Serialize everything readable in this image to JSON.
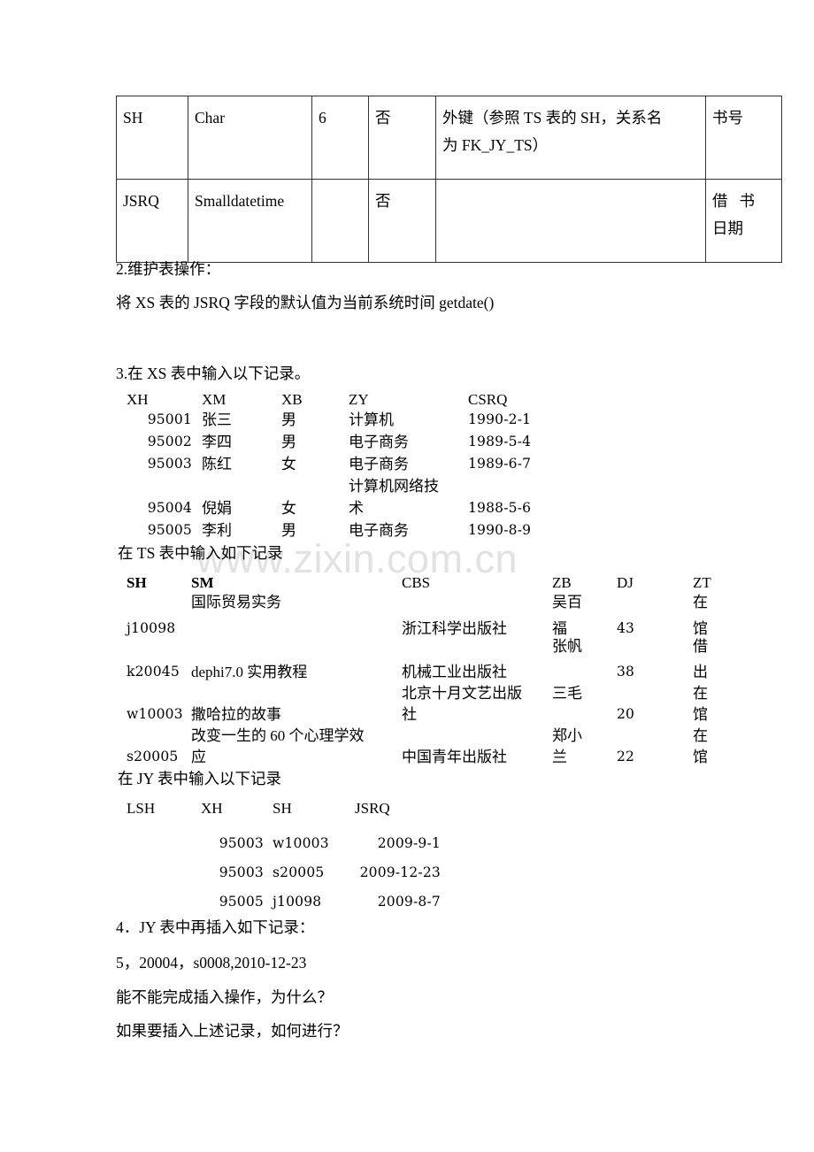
{
  "watermark": {
    "text": "www.zixin.com.cn",
    "color": "#e2e2e2"
  },
  "schema_table": {
    "rows": [
      {
        "field": "SH",
        "type": "Char",
        "length": "6",
        "nullable": "否",
        "constraint_line1": "外键（参照 TS 表的 SH，关系名",
        "constraint_line2": "为 FK_JY_TS）",
        "comment_line1": "书号",
        "comment_line2": ""
      },
      {
        "field": "JSRQ",
        "type": "Smalldatetime",
        "length": "",
        "nullable": "否",
        "constraint_line1": "",
        "constraint_line2": "",
        "comment_line1": "借 书",
        "comment_line2": "日期"
      }
    ]
  },
  "section2": {
    "heading": "2.维护表操作：",
    "body": "将 XS 表的 JSRQ 字段的默认值为当前系统时间 getdate()"
  },
  "section3": {
    "heading": "3.在 XS 表中输入以下记录。",
    "xs_headers": [
      "XH",
      "XM",
      "XB",
      "ZY",
      "CSRQ"
    ],
    "xs_rows": [
      {
        "XH": "95001",
        "XM": "张三",
        "XB": "男",
        "ZY": "计算机",
        "ZY2": "",
        "CSRQ": "1990-2-1"
      },
      {
        "XH": "95002",
        "XM": "李四",
        "XB": "男",
        "ZY": "电子商务",
        "ZY2": "",
        "CSRQ": "1989-5-4"
      },
      {
        "XH": "95003",
        "XM": "陈红",
        "XB": "女",
        "ZY": "电子商务",
        "ZY2": "",
        "CSRQ": "1989-6-7"
      },
      {
        "XH": "95004",
        "XM": "倪娟",
        "XB": "女",
        "ZY": "术",
        "ZY2": "计算机网络技",
        "CSRQ": "1988-5-6"
      },
      {
        "XH": "95005",
        "XM": "李利",
        "XB": "男",
        "ZY": "电子商务",
        "ZY2": "",
        "CSRQ": "1990-8-9"
      }
    ],
    "ts_intro": "在 TS 表中输入如下记录",
    "ts_headers": [
      "SH",
      "SM",
      "CBS",
      "ZB",
      "DJ",
      "ZT"
    ],
    "ts_rows": [
      {
        "SH": "j10098",
        "SM_top": "国际贸易实务",
        "SM": "",
        "CBS_top": "",
        "CBS": "浙江科学出版社",
        "ZB_top": "吴百",
        "ZB": "福",
        "DJ": "43",
        "ZT_top": "在",
        "ZT": "馆"
      },
      {
        "SH": "k20045",
        "SM_top": "",
        "SM": "dephi7.0 实用教程",
        "CBS_top": "",
        "CBS": "机械工业出版社",
        "ZB_top": "张帆",
        "ZB": "",
        "DJ": "38",
        "ZT_top": "借",
        "ZT": "出"
      },
      {
        "SH": "w10003",
        "SM_top": "",
        "SM": "撒哈拉的故事",
        "CBS_top": "北京十月文艺出版",
        "CBS": "社",
        "ZB_top": "三毛",
        "ZB": "",
        "DJ": "20",
        "ZT_top": "在",
        "ZT": "馆"
      },
      {
        "SH": "s20005",
        "SM_top": "改变一生的 60 个心理学效",
        "SM": "应",
        "CBS_top": "",
        "CBS": "中国青年出版社",
        "ZB_top": "郑小",
        "ZB": "兰",
        "DJ": "22",
        "ZT_top": "在",
        "ZT": "馆"
      }
    ],
    "jy_intro": "在 JY 表中输入以下记录",
    "jy_headers": [
      "LSH",
      "XH",
      "SH",
      "JSRQ"
    ],
    "jy_rows": [
      {
        "LSH": "",
        "XH": "95003",
        "SH": "w10003",
        "JSRQ": "2009-9-1"
      },
      {
        "LSH": "",
        "XH": "95003",
        "SH": "s20005",
        "JSRQ": "2009-12-23"
      },
      {
        "LSH": "",
        "XH": "95005",
        "SH": "j10098",
        "JSRQ": "2009-8-7"
      }
    ]
  },
  "section4": {
    "heading": "4．JY 表中再插入如下记录：",
    "record": "5，20004，s0008,2010-12-23",
    "question1": "能不能完成插入操作，为什么？",
    "question2": "如果要插入上述记录，如何进行？"
  }
}
